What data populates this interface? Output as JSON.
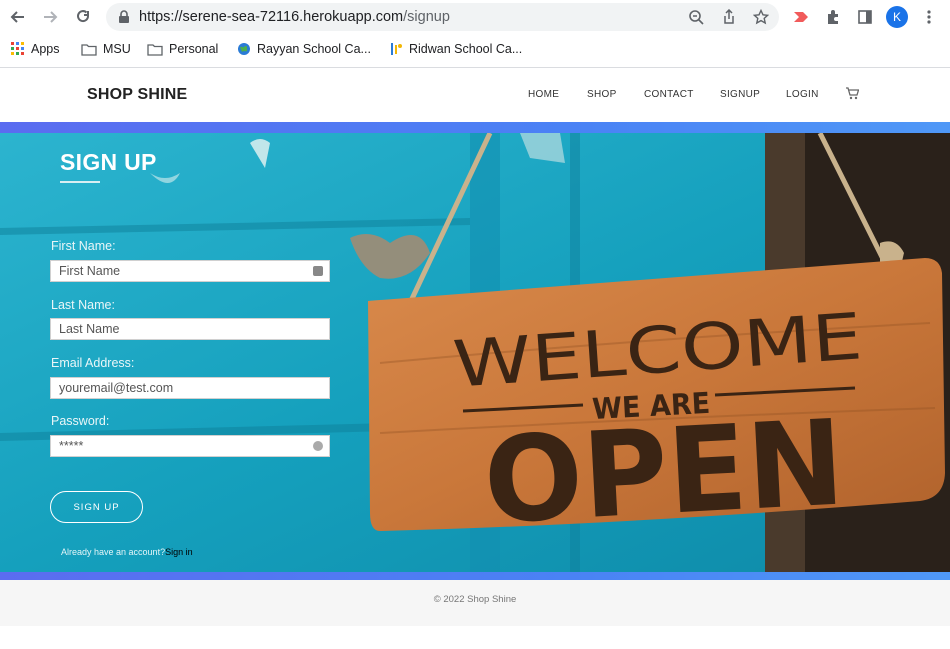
{
  "browser": {
    "url_main": "https://serene-sea-72116.herokuapp.com",
    "url_path": "/signup",
    "profile_initial": "K",
    "bookmarks": [
      {
        "label": "Apps"
      },
      {
        "label": "MSU"
      },
      {
        "label": "Personal"
      },
      {
        "label": "Rayyan School Ca..."
      },
      {
        "label": "Ridwan School Ca..."
      }
    ]
  },
  "site": {
    "brand": "SHOP SHINE",
    "nav": [
      "HOME",
      "SHOP",
      "CONTACT",
      "SIGNUP",
      "LOGIN"
    ]
  },
  "form": {
    "title": "SIGN UP",
    "first_name_label": "First Name:",
    "first_name_placeholder": "First Name",
    "last_name_label": "Last Name:",
    "last_name_placeholder": "Last Name",
    "email_label": "Email Address:",
    "email_placeholder": "youremail@test.com",
    "password_label": "Password:",
    "password_value": "*****",
    "submit_label": "SIGN UP",
    "already_text": "Already have an account?",
    "signin_link": "Sign in"
  },
  "hero_sign": {
    "line1": "WELCOME",
    "line2": "WE ARE",
    "line3": "OPEN"
  },
  "footer": {
    "copyright": "© 2022 Shop Shine"
  },
  "colors": {
    "accent_band": "#4a82f5",
    "hero_bg": "#19a7c4"
  }
}
